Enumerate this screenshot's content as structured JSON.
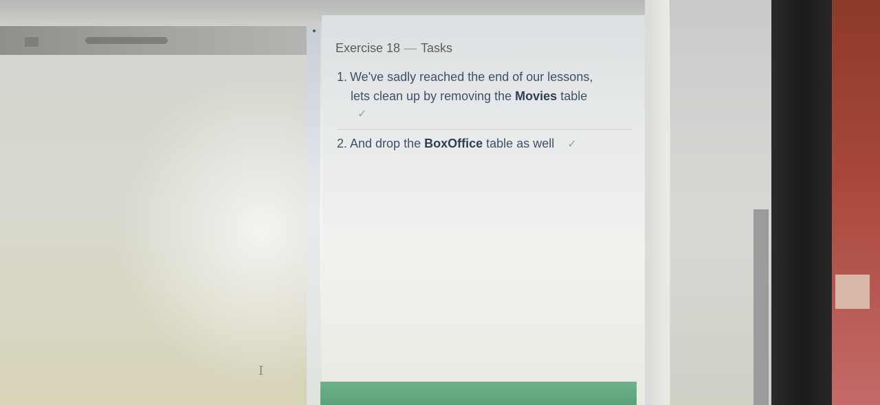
{
  "header": {
    "exercise": "Exercise 18",
    "separator": "—",
    "section": "Tasks"
  },
  "tasks": [
    {
      "number": "1.",
      "text_before": "We've sadly reached the end of our lessons,",
      "text_line2_before": "lets clean up by removing the",
      "bold": "Movies",
      "text_after": "table",
      "status": "✓"
    },
    {
      "number": "2.",
      "text_before": "And drop the",
      "bold": "BoxOffice",
      "text_after": "table as well",
      "status": "✓"
    }
  ],
  "colors": {
    "task_text": "#3f4f6a",
    "check": "#8fa7a0",
    "submit_bar": "#5aa27a"
  }
}
